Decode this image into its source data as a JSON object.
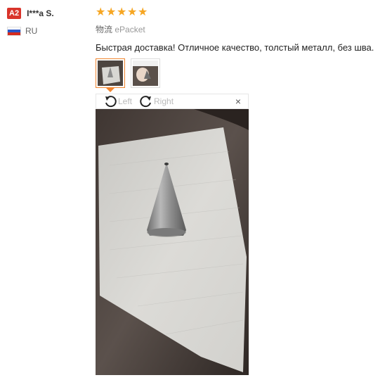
{
  "reviewer": {
    "level_badge": "A2",
    "name": "I***a S.",
    "country_code": "RU",
    "flag_colors": [
      "#ffffff",
      "#2a56c6",
      "#d52b1e"
    ]
  },
  "review": {
    "rating": 5,
    "rating_max": 5,
    "star_color": "#f6a623",
    "logistics_label": "物流",
    "logistics_value": "ePacket",
    "feedback_text": "Быстрая доставка! Отличное качество, толстый металл, без шва."
  },
  "photos": {
    "thumbnails": [
      "photo-1",
      "photo-2"
    ],
    "selected_index": 0
  },
  "viewer": {
    "rotate_left_label": "Left",
    "rotate_right_label": "Right",
    "close_symbol": "×",
    "accent_color": "#f1852f"
  }
}
